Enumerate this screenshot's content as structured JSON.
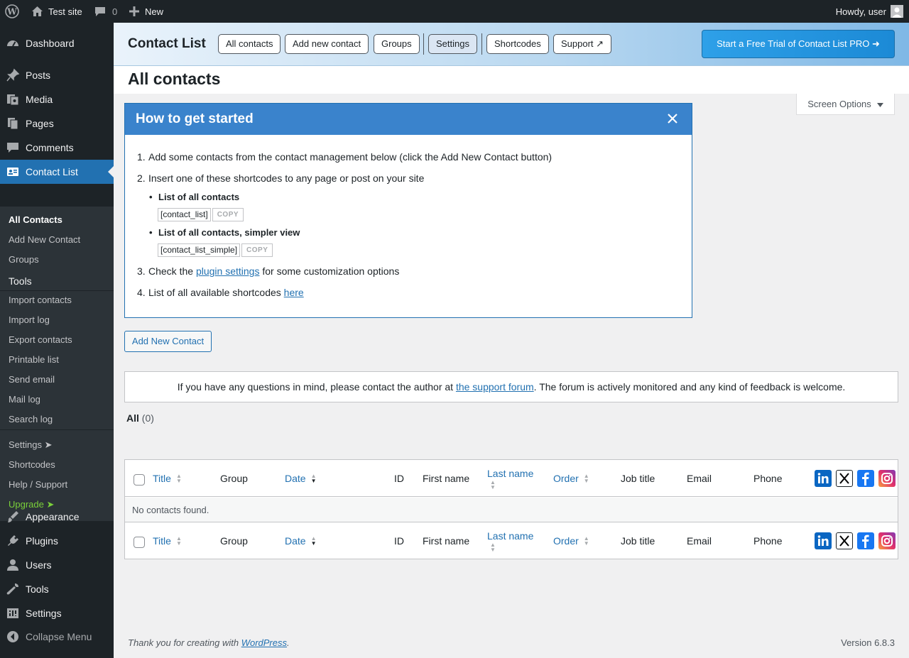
{
  "adminbar": {
    "site_name": "Test site",
    "comments_count": "0",
    "new_label": "New",
    "greeting": "Howdy, user"
  },
  "sidebar": {
    "items": [
      {
        "label": "Dashboard",
        "icon": "dashboard-icon"
      },
      {
        "label": "Posts",
        "icon": "pin-icon"
      },
      {
        "label": "Media",
        "icon": "media-icon"
      },
      {
        "label": "Pages",
        "icon": "pages-icon"
      },
      {
        "label": "Comments",
        "icon": "comment-icon"
      },
      {
        "label": "Contact List",
        "icon": "id-card-icon"
      },
      {
        "label": "Appearance",
        "icon": "brush-icon"
      },
      {
        "label": "Plugins",
        "icon": "plug-icon"
      },
      {
        "label": "Users",
        "icon": "user-icon"
      },
      {
        "label": "Tools",
        "icon": "wrench-icon"
      },
      {
        "label": "Settings",
        "icon": "sliders-icon"
      },
      {
        "label": "Collapse Menu",
        "icon": "collapse-icon"
      }
    ],
    "submenu": {
      "all_contacts": "All Contacts",
      "add_new_contact": "Add New Contact",
      "groups": "Groups",
      "tools_heading": "Tools",
      "import_contacts": "Import contacts",
      "import_log": "Import log",
      "export_contacts": "Export contacts",
      "printable_list": "Printable list",
      "send_email": "Send email",
      "mail_log": "Mail log",
      "search_log": "Search log",
      "settings": "Settings ➤",
      "shortcodes": "Shortcodes",
      "help_support": "Help / Support",
      "upgrade": "Upgrade ➤"
    }
  },
  "header": {
    "title": "Contact List",
    "buttons": {
      "all_contacts": "All contacts",
      "add_new_contact": "Add new contact",
      "groups": "Groups",
      "settings": "Settings",
      "shortcodes": "Shortcodes",
      "support": "Support ↗"
    },
    "pro_button": "Start a Free Trial of Contact List PRO ➜",
    "accent_color": "#2ea0e8"
  },
  "page": {
    "title": "All contacts",
    "screen_options": "Screen Options"
  },
  "getstarted": {
    "title": "How to get started",
    "step1": "Add some contacts from the contact management below (click the Add New Contact button)",
    "step2": "Insert one of these shortcodes to any page or post on your site",
    "bullet1": "List of all contacts",
    "code1": "[contact_list]",
    "bullet2": "List of all contacts, simpler view",
    "code2": "[contact_list_simple]",
    "copy_label": "COPY",
    "step3_pre": "Check the ",
    "step3_link": "plugin settings",
    "step3_post": " for some customization options",
    "step4_pre": "List of all available shortcodes ",
    "step4_link": "here",
    "header_color": "#3a83cc"
  },
  "add_new_button": "Add New Contact",
  "support_notice": {
    "pre": "If you have any questions in mind, please contact the author at ",
    "link": "the support forum",
    "post": ". The forum is actively monitored and any kind of feedback is welcome."
  },
  "filter": {
    "all_label": "All",
    "all_count": "(0)"
  },
  "table": {
    "columns": {
      "title": "Title",
      "group": "Group",
      "date": "Date",
      "id": "ID",
      "first_name": "First name",
      "last_name": "Last name",
      "order": "Order",
      "job_title": "Job title",
      "email": "Email",
      "phone": "Phone"
    },
    "social_icons": [
      "linkedin-icon",
      "x-icon",
      "facebook-icon",
      "instagram-icon"
    ],
    "empty_message": "No contacts found."
  },
  "footer": {
    "thanks_pre": "Thank you for creating with ",
    "thanks_link": "WordPress",
    "thanks_post": ".",
    "version": "Version 6.8.3"
  }
}
